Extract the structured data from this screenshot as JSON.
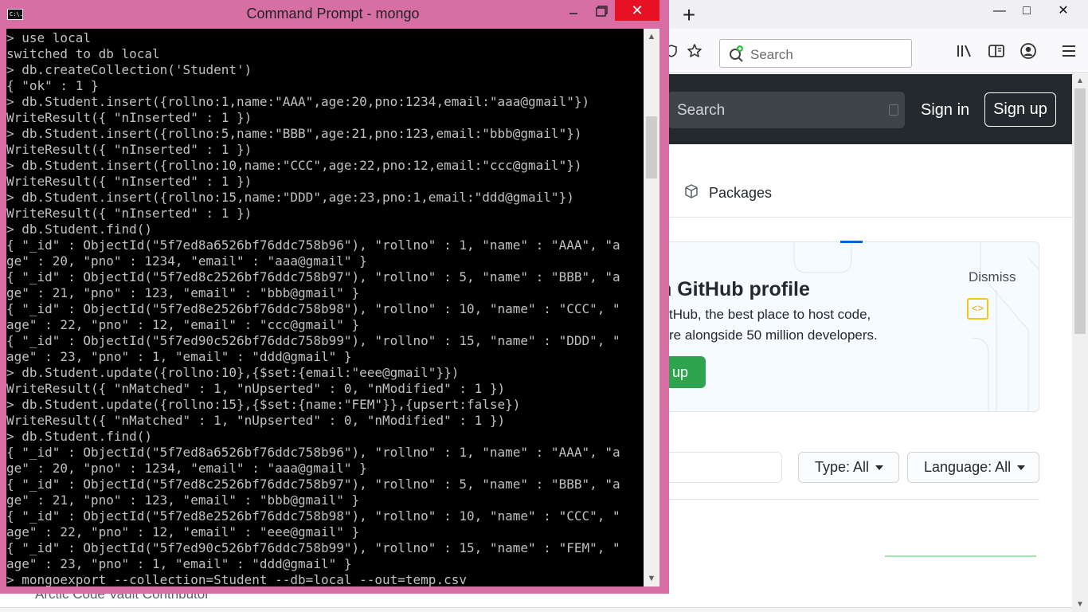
{
  "browser": {
    "new_tab": "+",
    "window_controls": {
      "minimize": "—",
      "maximize": "□",
      "close": "✕"
    },
    "search_placeholder": "Search",
    "icons": [
      "library-icon",
      "sidebar-icon",
      "account-icon",
      "menu-icon",
      "star-icon",
      "shield-icon"
    ]
  },
  "github": {
    "search_label": "Search",
    "sign_in": "Sign in",
    "sign_up": "Sign up",
    "packages_tab": "Packages",
    "banner": {
      "title": "n GitHub profile",
      "line1": "tHub, the best place to host code,",
      "line2": "re alongside 50 million developers.",
      "dismiss": "Dismiss",
      "button": "up"
    },
    "filters": {
      "type_label": "Type:",
      "type_value": "All",
      "language_label": "Language:",
      "language_value": "All"
    },
    "behind_text": "Arctic Code Vault Contributor"
  },
  "cmd": {
    "title": "Command Prompt - mongo",
    "icon_text": "C:\\.",
    "close_symbol": "✕",
    "lines": [
      "> use local",
      "switched to db local",
      "> db.createCollection('Student')",
      "{ \"ok\" : 1 }",
      "> db.Student.insert({rollno:1,name:\"AAA\",age:20,pno:1234,email:\"aaa@gmail\"})",
      "WriteResult({ \"nInserted\" : 1 })",
      "> db.Student.insert({rollno:5,name:\"BBB\",age:21,pno:123,email:\"bbb@gmail\"})",
      "WriteResult({ \"nInserted\" : 1 })",
      "> db.Student.insert({rollno:10,name:\"CCC\",age:22,pno:12,email:\"ccc@gmail\"})",
      "WriteResult({ \"nInserted\" : 1 })",
      "> db.Student.insert({rollno:15,name:\"DDD\",age:23,pno:1,email:\"ddd@gmail\"})",
      "WriteResult({ \"nInserted\" : 1 })",
      "> db.Student.find()",
      "{ \"_id\" : ObjectId(\"5f7ed8a6526bf76ddc758b96\"), \"rollno\" : 1, \"name\" : \"AAA\", \"a",
      "ge\" : 20, \"pno\" : 1234, \"email\" : \"aaa@gmail\" }",
      "{ \"_id\" : ObjectId(\"5f7ed8c2526bf76ddc758b97\"), \"rollno\" : 5, \"name\" : \"BBB\", \"a",
      "ge\" : 21, \"pno\" : 123, \"email\" : \"bbb@gmail\" }",
      "{ \"_id\" : ObjectId(\"5f7ed8e2526bf76ddc758b98\"), \"rollno\" : 10, \"name\" : \"CCC\", \"",
      "age\" : 22, \"pno\" : 12, \"email\" : \"ccc@gmail\" }",
      "{ \"_id\" : ObjectId(\"5f7ed90c526bf76ddc758b99\"), \"rollno\" : 15, \"name\" : \"DDD\", \"",
      "age\" : 23, \"pno\" : 1, \"email\" : \"ddd@gmail\" }",
      "> db.Student.update({rollno:10},{$set:{email:\"eee@gmail\"}})",
      "WriteResult({ \"nMatched\" : 1, \"nUpserted\" : 0, \"nModified\" : 1 })",
      "> db.Student.update({rollno:15},{$set:{name:\"FEM\"}},{upsert:false})",
      "WriteResult({ \"nMatched\" : 1, \"nUpserted\" : 0, \"nModified\" : 1 })",
      "> db.Student.find()",
      "{ \"_id\" : ObjectId(\"5f7ed8a6526bf76ddc758b96\"), \"rollno\" : 1, \"name\" : \"AAA\", \"a",
      "ge\" : 20, \"pno\" : 1234, \"email\" : \"aaa@gmail\" }",
      "{ \"_id\" : ObjectId(\"5f7ed8c2526bf76ddc758b97\"), \"rollno\" : 5, \"name\" : \"BBB\", \"a",
      "ge\" : 21, \"pno\" : 123, \"email\" : \"bbb@gmail\" }",
      "{ \"_id\" : ObjectId(\"5f7ed8e2526bf76ddc758b98\"), \"rollno\" : 10, \"name\" : \"CCC\", \"",
      "age\" : 22, \"pno\" : 12, \"email\" : \"eee@gmail\" }",
      "{ \"_id\" : ObjectId(\"5f7ed90c526bf76ddc758b99\"), \"rollno\" : 15, \"name\" : \"FEM\", \"",
      "age\" : 23, \"pno\" : 1, \"email\" : \"ddd@gmail\" }",
      "> mongoexport --collection=Student --db=local --out=temp.csv"
    ]
  },
  "colors": {
    "cmd_frame": "#d76fa5",
    "console_bg": "#000000",
    "console_text": "#c0c0c0",
    "close_red": "#e81123",
    "github_header": "#24292e",
    "github_green": "#2ea44f"
  }
}
